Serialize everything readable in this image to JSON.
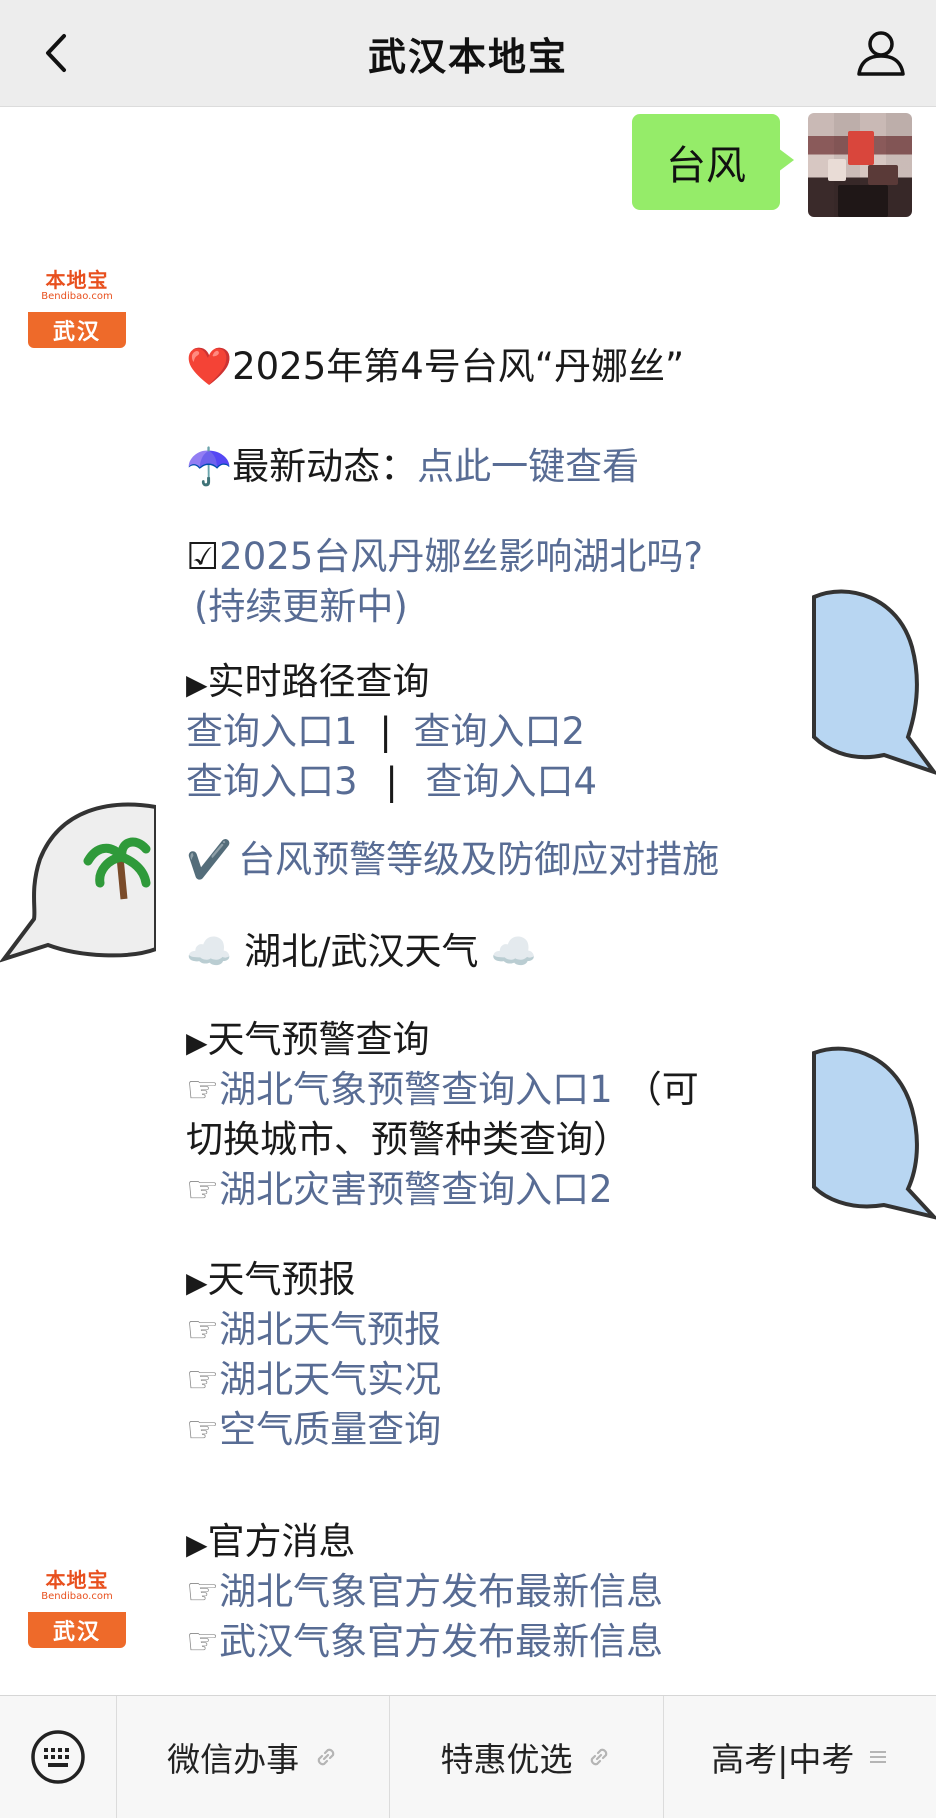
{
  "header": {
    "title": "武汉本地宝"
  },
  "chat": {
    "outgoing": {
      "text": "台风"
    },
    "bot": {
      "logo_cn": "本地宝",
      "logo_en": "Bendibao.com",
      "city": "武汉"
    }
  },
  "message": {
    "title_icon": "❤️",
    "title": "2025年第4号台风“丹娜丝”",
    "latest_icon": "☂️",
    "latest_label": "最新动态：",
    "latest_link": "点此一键查看",
    "impact_icon": "☑",
    "impact_link_1": "2025台风丹娜丝影响湖北吗?",
    "impact_link_2": "(持续更新中)",
    "route_marker": "▶",
    "route_title": "实时路径查询",
    "route_links": [
      "查询入口1",
      "查询入口2",
      "查询入口3",
      "查询入口4"
    ],
    "route_sep": "|",
    "warning_icon": "✔️",
    "warning_link": "台风预警等级及防御应对措施",
    "weather_cloud": "☁️",
    "weather_title": "湖北/武汉天气",
    "alert_marker": "▶",
    "alert_title": "天气预警查询",
    "pointer": "☞",
    "alert_link_1": "湖北气象预警查询入口1",
    "alert_note_1": "（可",
    "alert_note_2": "切换城市、预警种类查询）",
    "alert_link_2": "湖北灾害预警查询入口2",
    "forecast_marker": "▶",
    "forecast_title": "天气预报",
    "forecast_links": [
      "湖北天气预报",
      "湖北天气实况",
      "空气质量查询"
    ],
    "official_marker": "▶",
    "official_title": "官方消息",
    "official_links": [
      "湖北气象官方发布最新信息",
      "武汉气象官方发布最新信息"
    ]
  },
  "bottom_menu": {
    "items": [
      {
        "label": "微信办事",
        "suffix": "🔗"
      },
      {
        "label": "特惠优选",
        "suffix": "🔗"
      },
      {
        "label": "高考|中考",
        "suffix": "≡"
      }
    ]
  },
  "colors": {
    "header_bg": "#ededed",
    "bubble_green": "#95ec69",
    "link": "#586c94",
    "logo_orange": "#ee6a2a"
  },
  "icons": [
    "chevron-left-icon",
    "user-icon",
    "keyboard-icon",
    "link-icon",
    "menu-lines-icon"
  ]
}
